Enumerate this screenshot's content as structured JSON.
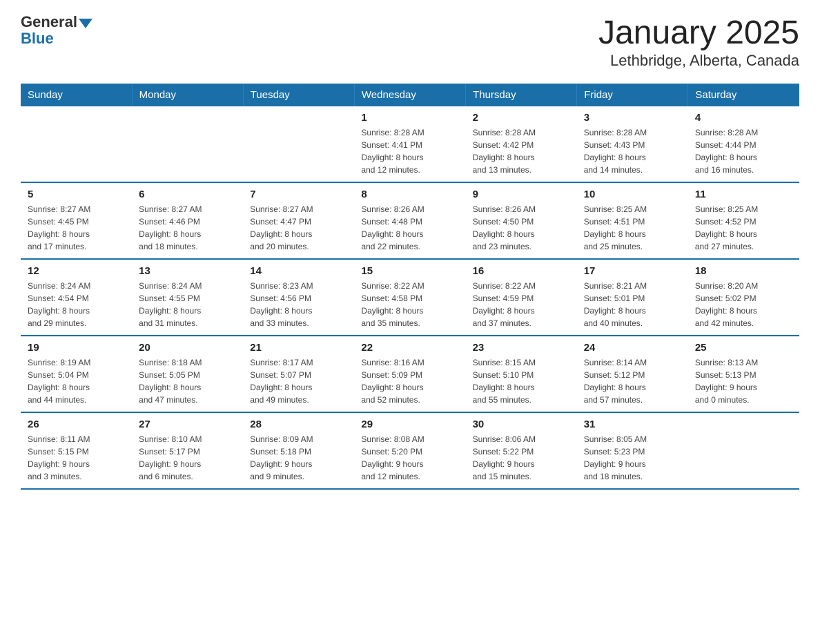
{
  "header": {
    "logo_general": "General",
    "logo_blue": "Blue",
    "title": "January 2025",
    "subtitle": "Lethbridge, Alberta, Canada"
  },
  "days_of_week": [
    "Sunday",
    "Monday",
    "Tuesday",
    "Wednesday",
    "Thursday",
    "Friday",
    "Saturday"
  ],
  "weeks": [
    [
      {
        "day": "",
        "info": ""
      },
      {
        "day": "",
        "info": ""
      },
      {
        "day": "",
        "info": ""
      },
      {
        "day": "1",
        "info": "Sunrise: 8:28 AM\nSunset: 4:41 PM\nDaylight: 8 hours\nand 12 minutes."
      },
      {
        "day": "2",
        "info": "Sunrise: 8:28 AM\nSunset: 4:42 PM\nDaylight: 8 hours\nand 13 minutes."
      },
      {
        "day": "3",
        "info": "Sunrise: 8:28 AM\nSunset: 4:43 PM\nDaylight: 8 hours\nand 14 minutes."
      },
      {
        "day": "4",
        "info": "Sunrise: 8:28 AM\nSunset: 4:44 PM\nDaylight: 8 hours\nand 16 minutes."
      }
    ],
    [
      {
        "day": "5",
        "info": "Sunrise: 8:27 AM\nSunset: 4:45 PM\nDaylight: 8 hours\nand 17 minutes."
      },
      {
        "day": "6",
        "info": "Sunrise: 8:27 AM\nSunset: 4:46 PM\nDaylight: 8 hours\nand 18 minutes."
      },
      {
        "day": "7",
        "info": "Sunrise: 8:27 AM\nSunset: 4:47 PM\nDaylight: 8 hours\nand 20 minutes."
      },
      {
        "day": "8",
        "info": "Sunrise: 8:26 AM\nSunset: 4:48 PM\nDaylight: 8 hours\nand 22 minutes."
      },
      {
        "day": "9",
        "info": "Sunrise: 8:26 AM\nSunset: 4:50 PM\nDaylight: 8 hours\nand 23 minutes."
      },
      {
        "day": "10",
        "info": "Sunrise: 8:25 AM\nSunset: 4:51 PM\nDaylight: 8 hours\nand 25 minutes."
      },
      {
        "day": "11",
        "info": "Sunrise: 8:25 AM\nSunset: 4:52 PM\nDaylight: 8 hours\nand 27 minutes."
      }
    ],
    [
      {
        "day": "12",
        "info": "Sunrise: 8:24 AM\nSunset: 4:54 PM\nDaylight: 8 hours\nand 29 minutes."
      },
      {
        "day": "13",
        "info": "Sunrise: 8:24 AM\nSunset: 4:55 PM\nDaylight: 8 hours\nand 31 minutes."
      },
      {
        "day": "14",
        "info": "Sunrise: 8:23 AM\nSunset: 4:56 PM\nDaylight: 8 hours\nand 33 minutes."
      },
      {
        "day": "15",
        "info": "Sunrise: 8:22 AM\nSunset: 4:58 PM\nDaylight: 8 hours\nand 35 minutes."
      },
      {
        "day": "16",
        "info": "Sunrise: 8:22 AM\nSunset: 4:59 PM\nDaylight: 8 hours\nand 37 minutes."
      },
      {
        "day": "17",
        "info": "Sunrise: 8:21 AM\nSunset: 5:01 PM\nDaylight: 8 hours\nand 40 minutes."
      },
      {
        "day": "18",
        "info": "Sunrise: 8:20 AM\nSunset: 5:02 PM\nDaylight: 8 hours\nand 42 minutes."
      }
    ],
    [
      {
        "day": "19",
        "info": "Sunrise: 8:19 AM\nSunset: 5:04 PM\nDaylight: 8 hours\nand 44 minutes."
      },
      {
        "day": "20",
        "info": "Sunrise: 8:18 AM\nSunset: 5:05 PM\nDaylight: 8 hours\nand 47 minutes."
      },
      {
        "day": "21",
        "info": "Sunrise: 8:17 AM\nSunset: 5:07 PM\nDaylight: 8 hours\nand 49 minutes."
      },
      {
        "day": "22",
        "info": "Sunrise: 8:16 AM\nSunset: 5:09 PM\nDaylight: 8 hours\nand 52 minutes."
      },
      {
        "day": "23",
        "info": "Sunrise: 8:15 AM\nSunset: 5:10 PM\nDaylight: 8 hours\nand 55 minutes."
      },
      {
        "day": "24",
        "info": "Sunrise: 8:14 AM\nSunset: 5:12 PM\nDaylight: 8 hours\nand 57 minutes."
      },
      {
        "day": "25",
        "info": "Sunrise: 8:13 AM\nSunset: 5:13 PM\nDaylight: 9 hours\nand 0 minutes."
      }
    ],
    [
      {
        "day": "26",
        "info": "Sunrise: 8:11 AM\nSunset: 5:15 PM\nDaylight: 9 hours\nand 3 minutes."
      },
      {
        "day": "27",
        "info": "Sunrise: 8:10 AM\nSunset: 5:17 PM\nDaylight: 9 hours\nand 6 minutes."
      },
      {
        "day": "28",
        "info": "Sunrise: 8:09 AM\nSunset: 5:18 PM\nDaylight: 9 hours\nand 9 minutes."
      },
      {
        "day": "29",
        "info": "Sunrise: 8:08 AM\nSunset: 5:20 PM\nDaylight: 9 hours\nand 12 minutes."
      },
      {
        "day": "30",
        "info": "Sunrise: 8:06 AM\nSunset: 5:22 PM\nDaylight: 9 hours\nand 15 minutes."
      },
      {
        "day": "31",
        "info": "Sunrise: 8:05 AM\nSunset: 5:23 PM\nDaylight: 9 hours\nand 18 minutes."
      },
      {
        "day": "",
        "info": ""
      }
    ]
  ]
}
